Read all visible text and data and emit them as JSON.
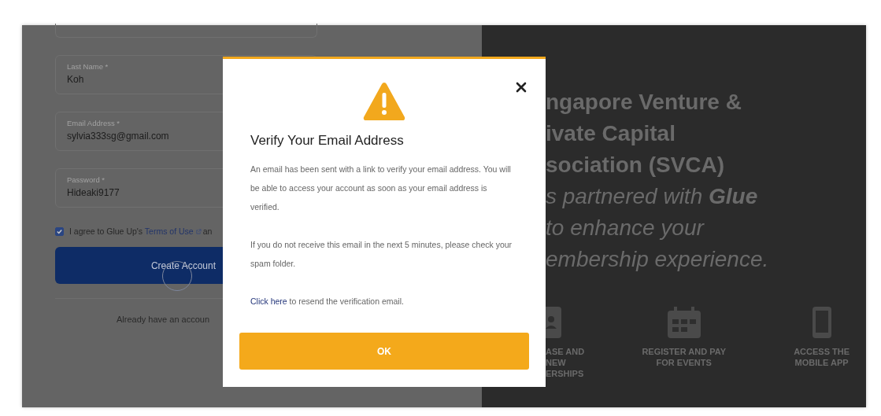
{
  "form": {
    "fields": [
      {
        "label": "Last Name *",
        "value": "Koh"
      },
      {
        "label": "Email Address *",
        "value": "sylvia333sg@gmail.com"
      },
      {
        "label": "Password *",
        "value": "Hideaki9177"
      }
    ],
    "terms": {
      "checked": true,
      "before": "I agree to Glue Up's",
      "link": "Terms of Use",
      "after": "an"
    },
    "submit_button": "Create Account",
    "signin_prompt": "Already have an accoun"
  },
  "promo": {
    "headline": [
      "ngapore Venture &",
      "ivate Capital",
      "sociation (SVCA)"
    ],
    "tagline": [
      "s partnered with **Glue**",
      "to enhance your",
      "embership experience."
    ],
    "features": [
      {
        "kind": "membership",
        "label": [
          "ASE AND",
          "NEW",
          "ERSHIPS"
        ]
      },
      {
        "kind": "events",
        "label": [
          "REGISTER AND PAY",
          "FOR EVENTS"
        ]
      },
      {
        "kind": "mobile",
        "label": [
          "ACCESS THE",
          "MOBILE APP"
        ]
      }
    ]
  },
  "dialog": {
    "title": "Verify Your Email Address",
    "paragraphs": [
      "An email has been sent with a link to verify your email address. You will be able to access your account as soon as your email address is verified.",
      "If you do not receive this email in the next 5 minutes, please check your spam folder."
    ],
    "resend": {
      "link": "Click here",
      "text": "to resend the verification email."
    },
    "ok_button": "OK"
  }
}
